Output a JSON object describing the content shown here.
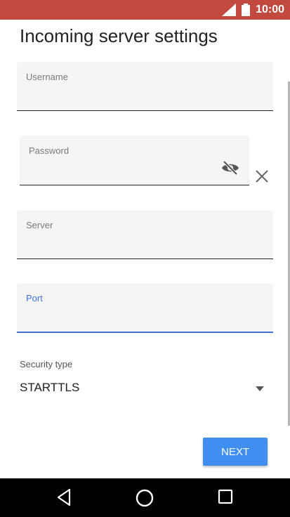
{
  "status_bar": {
    "time": "10:00",
    "icons": [
      "signal-icon",
      "battery-icon"
    ]
  },
  "page": {
    "title": "Incoming server settings"
  },
  "fields": {
    "username": {
      "label": "Username",
      "value": ""
    },
    "password": {
      "label": "Password",
      "value": "",
      "toggle_icon": "eye-off-icon",
      "clear_icon": "close-icon"
    },
    "server": {
      "label": "Server",
      "value": ""
    },
    "port": {
      "label": "Port",
      "value": "",
      "focused": true
    }
  },
  "security": {
    "label": "Security type",
    "value": "STARTTLS",
    "icon": "dropdown-icon"
  },
  "actions": {
    "next_label": "NEXT"
  },
  "colors": {
    "status_bar": "#c1493f",
    "accent": "#3f73d8",
    "button": "#3f8ef0",
    "nav_bar": "#000000"
  },
  "nav": {
    "icons": [
      "back-icon",
      "home-icon",
      "recents-icon"
    ]
  }
}
